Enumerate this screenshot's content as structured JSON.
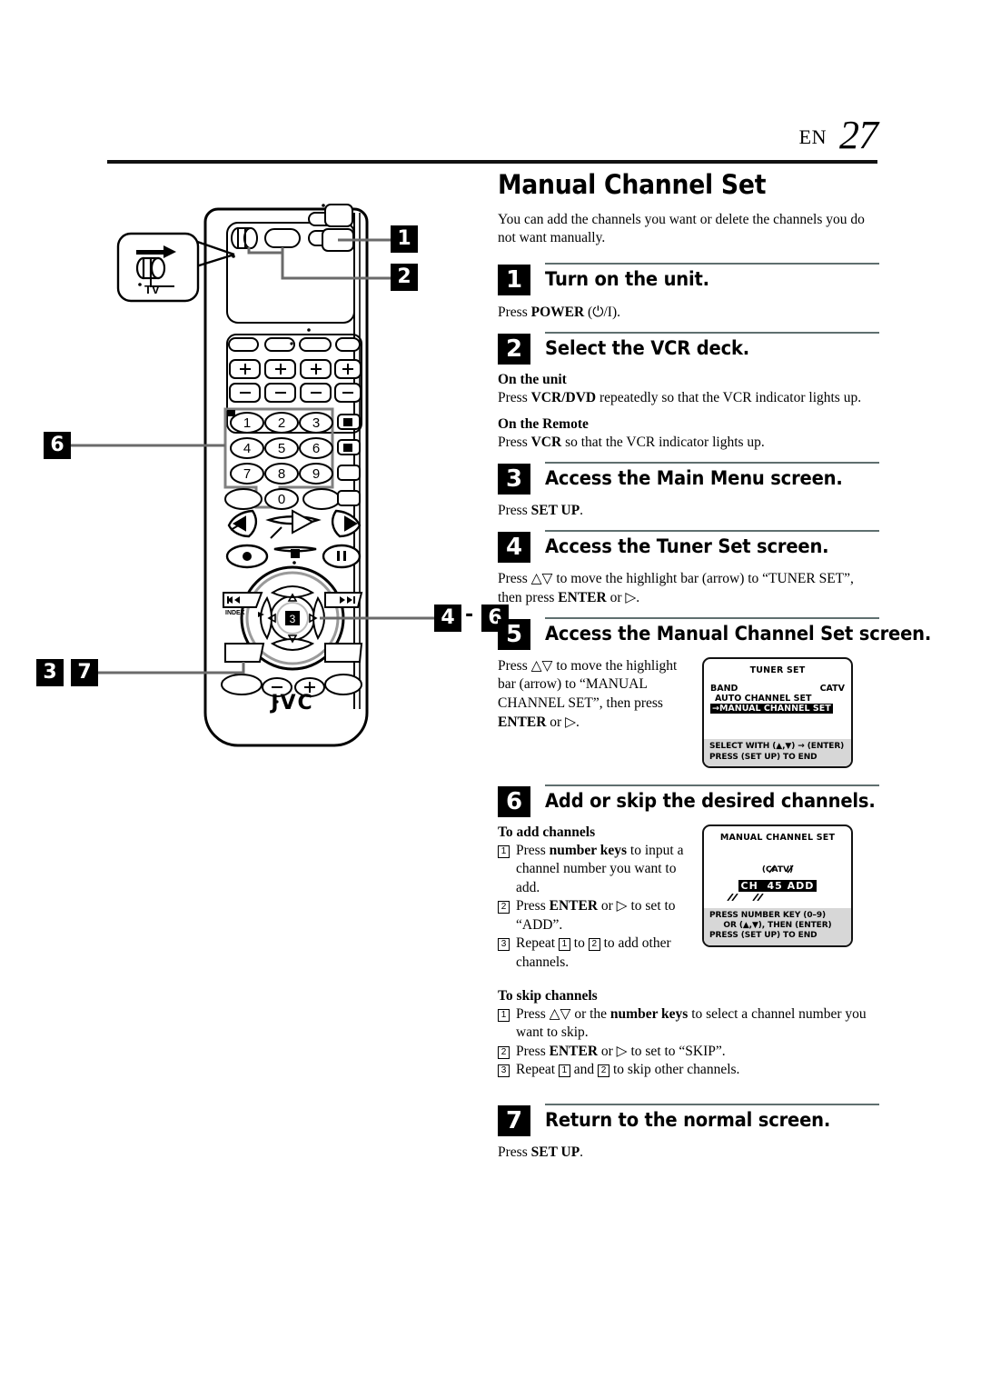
{
  "header": {
    "lang_code": "EN",
    "page_number": "27"
  },
  "doc": {
    "title": "Manual Channel Set",
    "intro": "You can add the channels you want or delete the channels you do not want manually."
  },
  "steps": [
    {
      "number": "1",
      "title": "Turn on the unit.",
      "body": "Press POWER (⏻/I)."
    },
    {
      "number": "2",
      "title": "Select the VCR deck.",
      "sub1_head": "On the unit",
      "sub1_body": "Press VCR/DVD repeatedly so that the VCR indicator lights up.",
      "sub2_head": "On the Remote",
      "sub2_body": "Press VCR so that the VCR indicator lights up."
    },
    {
      "number": "3",
      "title": "Access the Main Menu screen.",
      "body": "Press SET UP."
    },
    {
      "number": "4",
      "title": "Access the Tuner Set screen.",
      "body": "Press △▽ to move the highlight bar (arrow) to “TUNER SET”, then press ENTER or ▷."
    },
    {
      "number": "5",
      "title": "Access the Manual Channel Set screen.",
      "body": "Press △▽ to move the highlight bar (arrow) to “MANUAL CHANNEL SET”, then press ENTER or ▷."
    },
    {
      "number": "6",
      "title": "Add or skip the desired channels."
    },
    {
      "number": "7",
      "title": "Return to the normal screen.",
      "body": "Press SET UP."
    }
  ],
  "step6": {
    "add_head": "To add channels",
    "add_items": [
      {
        "num": "1",
        "text_a": "Press the ",
        "bold": "number keys",
        "text_b": " to input a channel number you want to add."
      },
      {
        "num": "2",
        "text_a": "Press ",
        "bold": "ENTER",
        "text_b": " or ▷ to set to “ADD”."
      },
      {
        "num": "3",
        "text_a": "Repeat ",
        "bold": "",
        "text_b": " to add other channels.",
        "ref1": "1",
        "ref2": "2",
        "mid": " to "
      }
    ],
    "skip_head": "To skip channels",
    "skip_items": [
      {
        "num": "1",
        "text_a": "Press △▽ or the ",
        "bold": "number keys",
        "text_b": " to select a channel number you want to skip."
      },
      {
        "num": "2",
        "text_a": "Press ",
        "bold": "ENTER",
        "text_b": " or ▷ to set to “SKIP”."
      },
      {
        "num": "3",
        "text_a": "Repeat ",
        "bold": "",
        "text_b": " to skip other channels.",
        "ref1": "1",
        "ref2": "2",
        "mid": " and "
      }
    ]
  },
  "osd_tuner_set": {
    "title": "TUNER SET",
    "row_band_label": "BAND",
    "row_band_value": "CATV",
    "row_auto": "AUTO CHANNEL SET",
    "row_manual_highlight": "→MANUAL CHANNEL SET",
    "footer_line1": "SELECT WITH (▲,▼) → (ENTER)",
    "footer_line2": "PRESS (SET UP) TO END"
  },
  "osd_manual_channel_set": {
    "title": "MANUAL CHANNEL SET",
    "band_label": "(CATV)",
    "ch_label": "CH",
    "ch_number": "45",
    "ch_state": "ADD",
    "footer_line1": "PRESS NUMBER KEY (0–9)",
    "footer_line2": "OR (▲,▼), THEN (ENTER)",
    "footer_line3": "PRESS (SET UP) TO END"
  },
  "figure": {
    "brand": "JVC",
    "tv_switch_label": "TV",
    "keypad_digits": [
      "1",
      "2",
      "3",
      "4",
      "5",
      "6",
      "7",
      "8",
      "9",
      "0"
    ],
    "callouts": [
      {
        "id": "c1",
        "label": "1"
      },
      {
        "id": "c2",
        "label": "2"
      },
      {
        "id": "c6",
        "label": "6"
      },
      {
        "id": "c3",
        "label": "3"
      },
      {
        "id": "c7",
        "label": "7"
      },
      {
        "id": "c4",
        "label": "4"
      },
      {
        "id": "c4dash",
        "label": "-"
      },
      {
        "id": "c6b",
        "label": "6"
      }
    ],
    "small_labels": {
      "index": "INDEX"
    }
  },
  "colors": {
    "rule": "#5f6f6f",
    "badge_bg": "#000000",
    "osd_footer_bg": "#d7d7d7",
    "remote_body": "#ffffff"
  }
}
